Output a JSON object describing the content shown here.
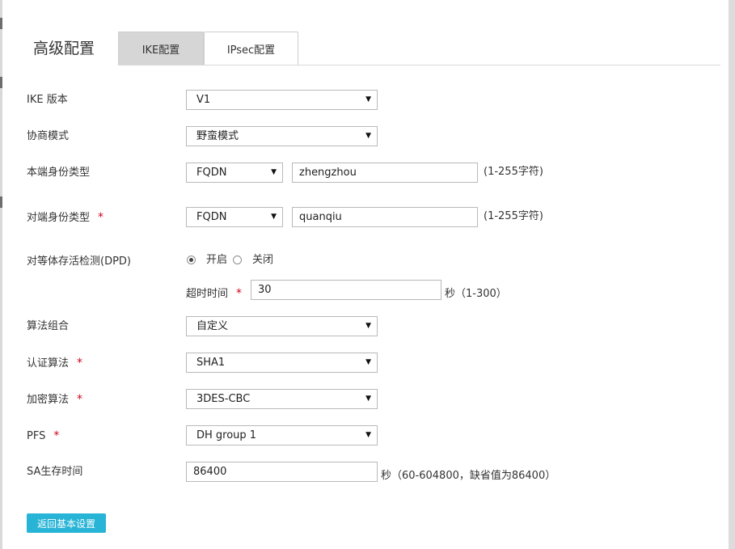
{
  "title": "高级配置",
  "tabs": [
    {
      "label": "IKE配置",
      "active": true
    },
    {
      "label": "IPsec配置",
      "active": false
    }
  ],
  "form": {
    "ike_version": {
      "label": "IKE 版本",
      "value": "V1"
    },
    "negotiation_mode": {
      "label": "协商模式",
      "value": "野蛮模式"
    },
    "local_identity": {
      "label": "本端身份类型",
      "type": "FQDN",
      "value": "zhengzhou",
      "hint": "(1-255字符)"
    },
    "peer_identity": {
      "label": "对端身份类型",
      "required": "*",
      "type": "FQDN",
      "value": "quanqiu",
      "hint": "(1-255字符)"
    },
    "dpd": {
      "label": "对等体存活检测(DPD)",
      "on_label": "开启",
      "off_label": "关闭",
      "selected": "on",
      "timeout_label": "超时时间",
      "timeout_required": "*",
      "timeout_value": "30",
      "timeout_hint": "秒（1-300）"
    },
    "algorithm_combo": {
      "label": "算法组合",
      "value": "自定义"
    },
    "auth_algorithm": {
      "label": "认证算法",
      "required": "*",
      "value": "SHA1"
    },
    "encryption_algorithm": {
      "label": "加密算法",
      "required": "*",
      "value": "3DES-CBC"
    },
    "pfs": {
      "label": "PFS",
      "required": "*",
      "value": "DH group 1"
    },
    "sa_lifetime": {
      "label": "SA生存时间",
      "value": "86400",
      "hint": "秒（60-604800，缺省值为86400）"
    }
  },
  "back_button": {
    "label": "返回基本设置"
  },
  "icons": {
    "caret": "caret-down-icon",
    "required": "required-asterisk"
  },
  "colors": {
    "button": "#28b4d6",
    "required": "#d0021b",
    "active_tab": "#d6d6d6"
  }
}
